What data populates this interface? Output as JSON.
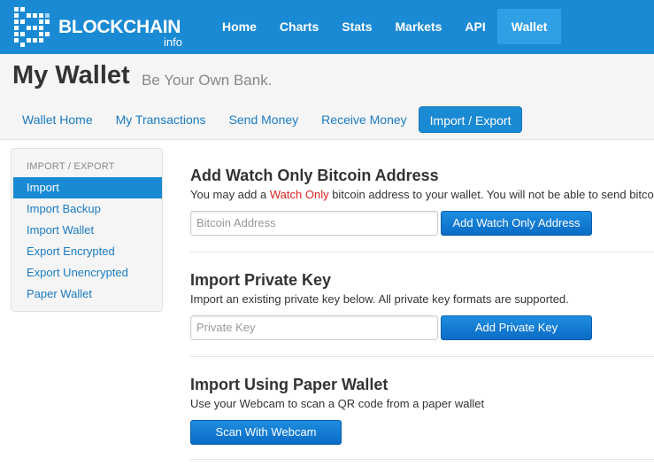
{
  "brand": {
    "name": "BLOCKCHAIN",
    "sub": "info"
  },
  "topnav": [
    "Home",
    "Charts",
    "Stats",
    "Markets",
    "API",
    "Wallet"
  ],
  "header": {
    "title": "My Wallet",
    "subtitle": "Be Your Own Bank."
  },
  "subnav": [
    "Wallet Home",
    "My Transactions",
    "Send Money",
    "Receive Money",
    "Import / Export"
  ],
  "sidebar": {
    "heading": "IMPORT / EXPORT",
    "items": [
      "Import",
      "Import Backup",
      "Import Wallet",
      "Export Encrypted",
      "Export Unencrypted",
      "Paper Wallet"
    ]
  },
  "sections": {
    "watch": {
      "title": "Add Watch Only Bitcoin Address",
      "desc_before": "You may add a ",
      "desc_highlight": "Watch Only",
      "desc_after": " bitcoin address to your wallet. You will not be able to send bitcoins",
      "placeholder": "Bitcoin Address",
      "button": "Add Watch Only Address"
    },
    "privkey": {
      "title": "Import Private Key",
      "desc": "Import an existing private key below. All private key formats are supported.",
      "placeholder": "Private Key",
      "button": "Add Private Key"
    },
    "paper": {
      "title": "Import Using Paper Wallet",
      "desc": "Use your Webcam to scan a QR code from a paper wallet",
      "button": "Scan With Webcam"
    }
  },
  "colors": {
    "brand_blue": "#1a8ad4",
    "highlight_red": "#dd2222"
  }
}
